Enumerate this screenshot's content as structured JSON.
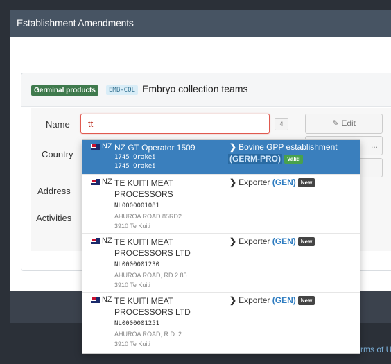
{
  "header": {
    "title": "Establishment Amendments"
  },
  "panel": {
    "section_badge": "Germinal products",
    "code_badge": "EMB-COL",
    "title": "Embryo collection teams"
  },
  "form": {
    "name_label": "Name",
    "name_value": "tt",
    "count": "4",
    "edit_label": "✎ Edit",
    "country_label": "Country",
    "address_label": "Address",
    "activities_label": "Activities",
    "ghost_label": "..."
  },
  "footer": {
    "terms": "rms of U"
  },
  "dropdown": {
    "items": [
      {
        "country": "NZ",
        "name": "NZ GT Operator 1509",
        "line1": "1745 Orakei",
        "line2": "1745 Orakei",
        "activity": "Bovine GPP establishment",
        "code": "(GERM-PRO)",
        "status": "Valid"
      },
      {
        "country": "NZ",
        "name": "TE KUITI MEAT PROCESSORS",
        "id": "NL0000001081",
        "line1": "AHUROA ROAD 85RD2",
        "line2": "3910 Te Kuiti",
        "activity": "Exporter",
        "code": "(GEN)",
        "status": "New"
      },
      {
        "country": "NZ",
        "name": "TE KUITI MEAT PROCESSORS LTD",
        "id": "NL0000001230",
        "line1": "AHUROA ROAD, RD 2 85",
        "line2": "3910 Te Kuiti",
        "activity": "Exporter",
        "code": "(GEN)",
        "status": "New"
      },
      {
        "country": "NZ",
        "name": "TE KUITI MEAT PROCESSORS LTD",
        "id": "NL0000001251",
        "line1": "AHUROA ROAD, R.D. 2",
        "line2": "3910 Te Kuiti",
        "activity": "Exporter",
        "code": "(GEN)",
        "status": "New"
      }
    ]
  }
}
